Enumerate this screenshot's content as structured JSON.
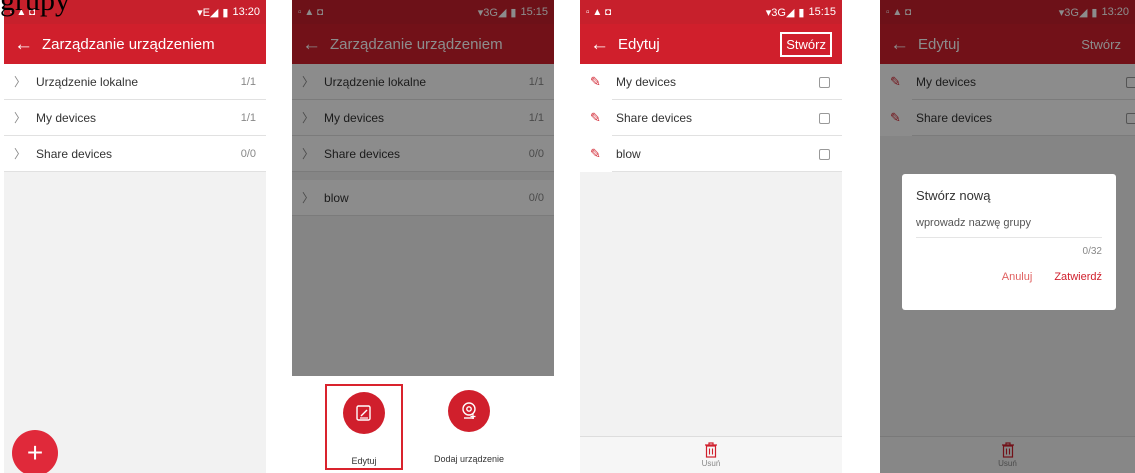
{
  "caption": "grupy",
  "screens": [
    {
      "status": {
        "left_icons": "▫ ▲ ◘",
        "network": "▾E◢",
        "battery": "▮",
        "time": "13:20"
      },
      "title": "Zarządzanie urządzeniem",
      "rows": [
        {
          "label": "Urządzenie lokalne",
          "count": "1/1"
        },
        {
          "label": "My devices",
          "count": "1/1"
        },
        {
          "label": "Share devices",
          "count": "0/0"
        }
      ],
      "fab": "+"
    },
    {
      "status": {
        "left_icons": "▫ ▲ ◘",
        "network": "▾3G◢",
        "battery": "▮",
        "time": "15:15"
      },
      "title": "Zarządzanie urządzeniem",
      "rows": [
        {
          "label": "Urządzenie lokalne",
          "count": "1/1"
        },
        {
          "label": "My devices",
          "count": "1/1"
        },
        {
          "label": "Share devices",
          "count": "0/0"
        },
        {
          "label": "blow",
          "count": "0/0"
        }
      ],
      "sheet": {
        "edit_label": "Edytuj",
        "add_label": "Dodaj urządzenie"
      }
    },
    {
      "status": {
        "left_icons": "▫ ▲ ◘",
        "network": "▾3G◢",
        "battery": "▮",
        "time": "15:15"
      },
      "title": "Edytuj",
      "action": "Stwórz",
      "rows": [
        {
          "label": "My devices"
        },
        {
          "label": "Share devices"
        },
        {
          "label": "blow"
        }
      ],
      "delete_label": "Usuń"
    },
    {
      "status": {
        "left_icons": "▫ ▲ ◘",
        "network": "▾3G◢",
        "battery": "▮",
        "time": "13:20"
      },
      "title": "Edytuj",
      "action": "Stwórz",
      "rows": [
        {
          "label": "My devices"
        },
        {
          "label": "Share devices"
        }
      ],
      "delete_label": "Usuń",
      "dialog": {
        "title": "Stwórz nową",
        "placeholder": "wprowadz nazwę grupy",
        "counter": "0/32",
        "cancel": "Anuluj",
        "confirm": "Zatwierdź"
      }
    }
  ]
}
